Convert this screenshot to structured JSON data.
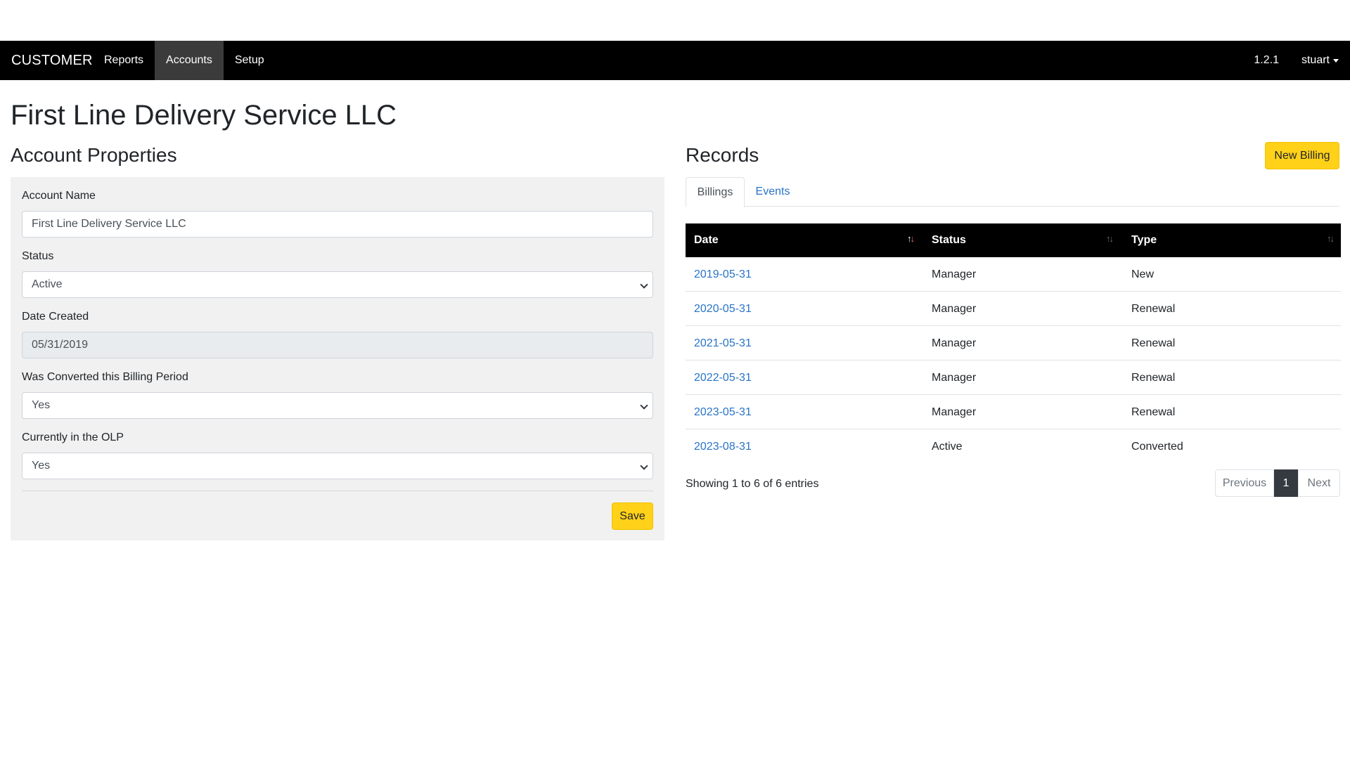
{
  "navbar": {
    "brand": "CUSTOMER",
    "items": [
      {
        "label": "Reports",
        "active": false
      },
      {
        "label": "Accounts",
        "active": true
      },
      {
        "label": "Setup",
        "active": false
      }
    ],
    "version": "1.2.1",
    "user": "stuart"
  },
  "page": {
    "title": "First Line Delivery Service LLC"
  },
  "account": {
    "heading": "Account Properties",
    "account_name_label": "Account Name",
    "account_name_value": "First Line Delivery Service LLC",
    "status_label": "Status",
    "status_value": "Active",
    "date_created_label": "Date Created",
    "date_created_value": "05/31/2019",
    "converted_label": "Was Converted this Billing Period",
    "converted_value": "Yes",
    "olp_label": "Currently in the OLP",
    "olp_value": "Yes",
    "save_label": "Save"
  },
  "records": {
    "heading": "Records",
    "new_billing_label": "New Billing",
    "tabs": [
      {
        "label": "Billings",
        "active": true
      },
      {
        "label": "Events",
        "active": false
      }
    ],
    "columns": [
      "Date",
      "Status",
      "Type"
    ],
    "rows": [
      {
        "date": "2019-05-31",
        "status": "Manager",
        "type": "New"
      },
      {
        "date": "2020-05-31",
        "status": "Manager",
        "type": "Renewal"
      },
      {
        "date": "2021-05-31",
        "status": "Manager",
        "type": "Renewal"
      },
      {
        "date": "2022-05-31",
        "status": "Manager",
        "type": "Renewal"
      },
      {
        "date": "2023-05-31",
        "status": "Manager",
        "type": "Renewal"
      },
      {
        "date": "2023-08-31",
        "status": "Active",
        "type": "Converted"
      }
    ],
    "info": "Showing 1 to 6 of 6 entries",
    "pagination": {
      "previous": "Previous",
      "current": "1",
      "next": "Next"
    }
  },
  "colors": {
    "navbar": "#000000",
    "accent_yellow": "#ffd119",
    "link_blue": "#2874c8",
    "panel_bg": "#f1f1f1"
  }
}
